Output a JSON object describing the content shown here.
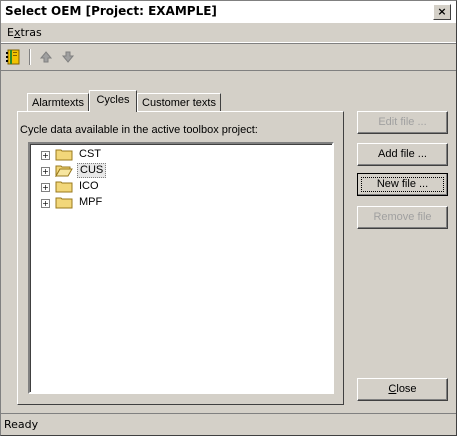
{
  "window": {
    "title": "Select OEM [Project: EXAMPLE]",
    "close_label": "×"
  },
  "menubar": {
    "items": [
      {
        "label": "Extras",
        "mnemonic": "x"
      }
    ]
  },
  "toolbar": {
    "icons": [
      "book-icon",
      "arrow-up-icon",
      "arrow-down-icon"
    ]
  },
  "tabs": [
    {
      "label": "Alarmtexts",
      "active": false
    },
    {
      "label": "Cycles",
      "active": true
    },
    {
      "label": "Customer texts",
      "active": false
    }
  ],
  "panel": {
    "caption": "Cycle data available in the active toolbox project:",
    "tree": [
      {
        "label": "CST",
        "expander": "+",
        "selected": false,
        "open": false
      },
      {
        "label": "CUS",
        "expander": "+",
        "selected": true,
        "open": true
      },
      {
        "label": "ICO",
        "expander": "+",
        "selected": false,
        "open": false
      },
      {
        "label": "MPF",
        "expander": "+",
        "selected": false,
        "open": false
      }
    ]
  },
  "buttons": {
    "edit_file": "Edit file ...",
    "add_file": "Add file ...",
    "new_file": "New file ...",
    "remove_file": "Remove file",
    "close": "Close"
  },
  "status": {
    "text": "Ready"
  },
  "colors": {
    "folder": "#f2d77a",
    "folder_edge": "#9a7a1c",
    "selection_bg": "#e8e8e8"
  }
}
